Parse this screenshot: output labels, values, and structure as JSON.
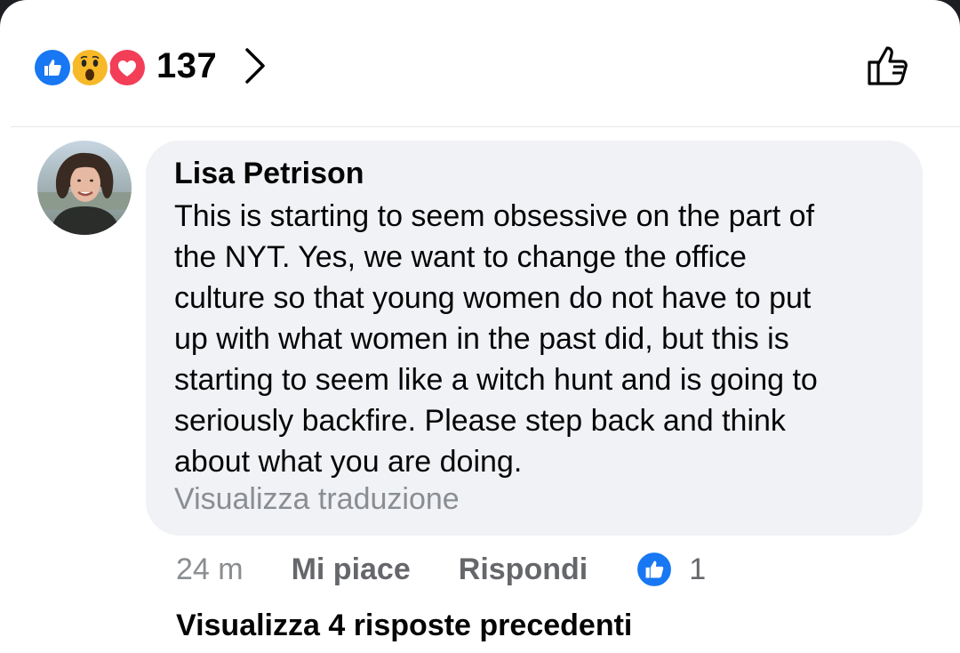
{
  "reactions": {
    "icons": [
      "like-icon",
      "wow-icon",
      "love-icon"
    ],
    "count": "137"
  },
  "comment": {
    "author": "Lisa Petrison",
    "text": "This is starting to seem obsessive on the part of\nthe NYT.  Yes, we want to change the office\nculture so that young women do not have to put\nup with what women in the past did, but this is\nstarting to seem like a witch hunt and is going to\nseriously backfire.  Please step back and think\nabout what you are doing.",
    "see_translation": "Visualizza traduzione",
    "time": "24 m",
    "like_action": "Mi piace",
    "reply_action": "Rispondi",
    "like_count": "1"
  },
  "view_previous_replies": "Visualizza 4 risposte precedenti",
  "colors": {
    "like_blue": "#1877f2",
    "love_red": "#f33e58",
    "wow_yellow": "#f7b928",
    "bubble_bg": "#f0f2f5",
    "secondary_text": "#65676b"
  }
}
